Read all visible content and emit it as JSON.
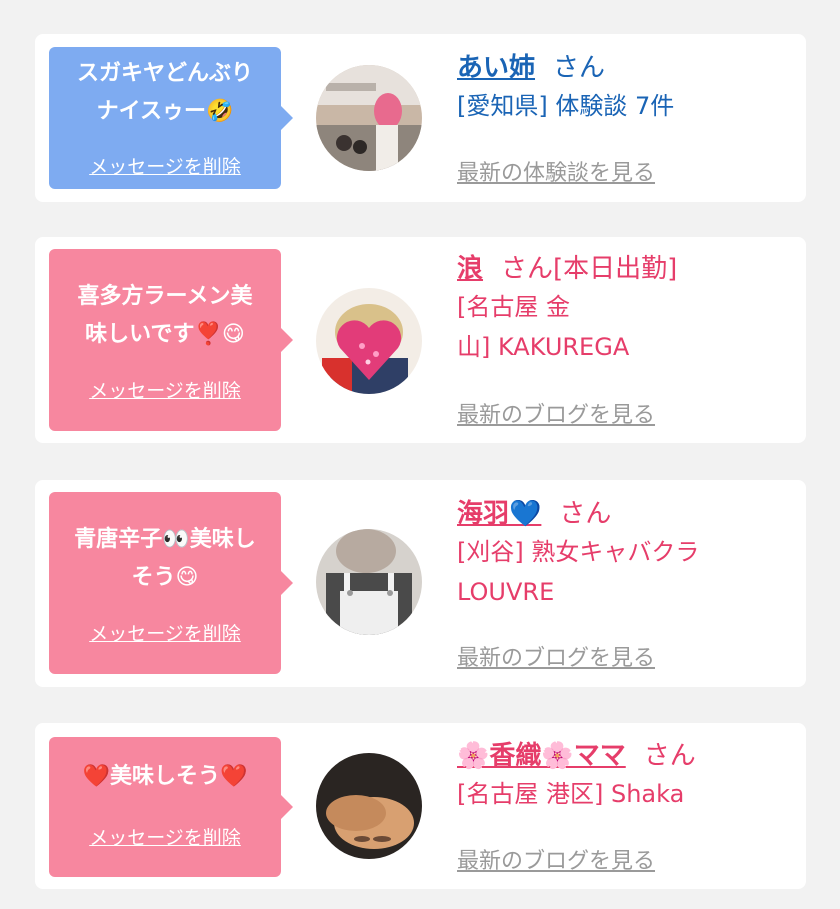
{
  "cards": [
    {
      "message_line1": "スガキヤどんぶり",
      "message_line2": "ナイスゥー🤣",
      "delete_label": "メッセージを削除",
      "name": "あい姉",
      "san": "さん",
      "detail_line1": "[愛知県] 体験談 7件",
      "more_label": "最新の体験談を見る",
      "accent": "#1a64b5",
      "bubble_color": "#7eabf1"
    },
    {
      "message_line1": "喜多方ラーメン美",
      "message_line2": "味しいです❣️😋",
      "delete_label": "メッセージを削除",
      "name": "浪",
      "san": "さん[本日出勤]",
      "detail_line1": "[名古屋 金",
      "detail_line2": "山] KAKUREGA",
      "more_label": "最新のブログを見る",
      "accent": "#e63d6a",
      "bubble_color": "#f7879f"
    },
    {
      "message_line1": "青唐辛子👀美味し",
      "message_line2": "そう😋",
      "delete_label": "メッセージを削除",
      "name": "海羽💙",
      "san": "さん",
      "detail_line1": "[刈谷] 熟女キャバクラ",
      "detail_line2": "LOUVRE",
      "more_label": "最新のブログを見る",
      "accent": "#e63d6a",
      "bubble_color": "#f7879f"
    },
    {
      "message_line1": "❤️美味しそう❤️",
      "delete_label": "メッセージを削除",
      "name": "🌸香織🌸ママ",
      "san": "さん",
      "detail_line1": "[名古屋 港区] Shaka",
      "more_label": "最新のブログを見る",
      "accent": "#e63d6a",
      "bubble_color": "#f7879f"
    }
  ]
}
